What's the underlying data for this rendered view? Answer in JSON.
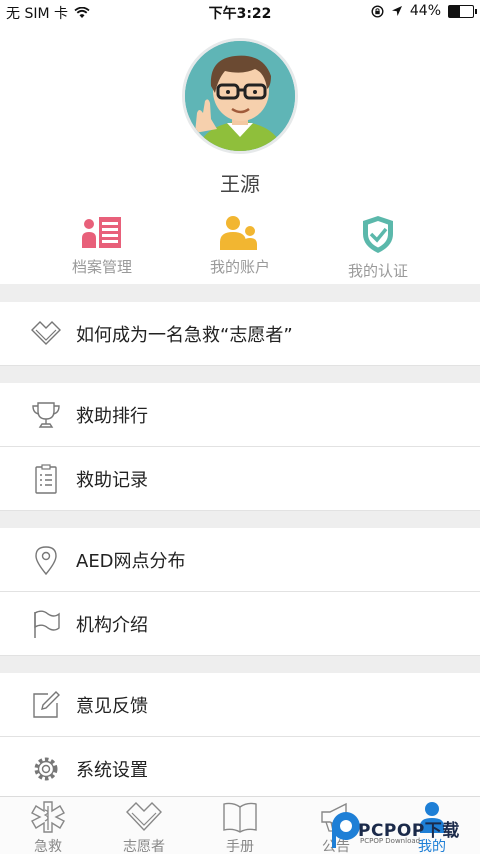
{
  "status_bar": {
    "carrier": "无 SIM 卡",
    "time": "下午3:22",
    "battery": "44%",
    "battery_level": 0.44
  },
  "profile": {
    "name": "王源"
  },
  "shortcuts": [
    {
      "label": "档案管理",
      "icon": "records-icon",
      "color": "#e8607a"
    },
    {
      "label": "我的账户",
      "icon": "account-icon",
      "color": "#f2b631"
    },
    {
      "label": "我的认证",
      "icon": "shield-check-icon",
      "color": "#5bb8ab"
    }
  ],
  "menu": {
    "volunteer": "如何成为一名急救“志愿者”",
    "ranking": "救助排行",
    "records": "救助记录",
    "aed": "AED网点分布",
    "organization": "机构介绍",
    "feedback": "意见反馈",
    "settings": "系统设置"
  },
  "tabs": [
    {
      "label": "急救",
      "icon": "first-aid-icon"
    },
    {
      "label": "志愿者",
      "icon": "volunteer-heart-icon"
    },
    {
      "label": "手册",
      "icon": "book-icon"
    },
    {
      "label": "公告",
      "icon": "megaphone-icon"
    },
    {
      "label": "我的",
      "icon": "user-icon",
      "active": true
    }
  ],
  "active_color": "#1e7fd6",
  "watermark": {
    "text": "PCPOP下载",
    "subtext": "PCPOP Download"
  }
}
